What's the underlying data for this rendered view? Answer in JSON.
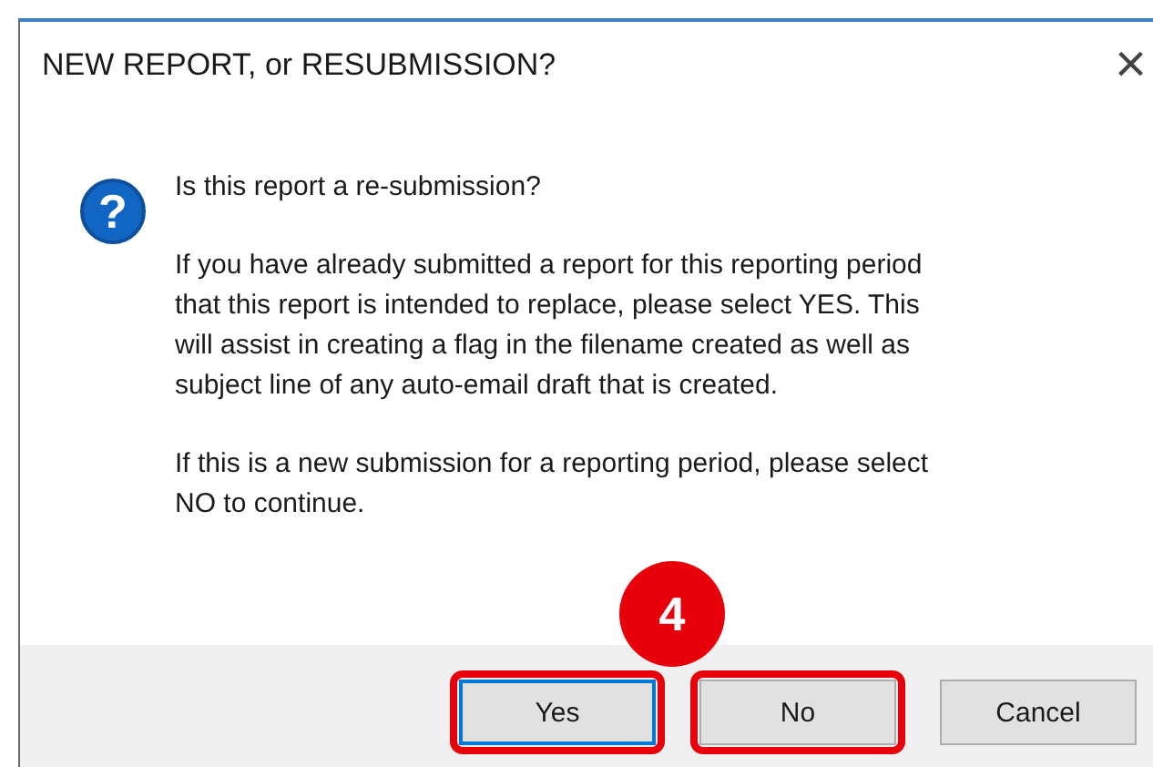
{
  "window": {
    "title": "NEW REPORT, or RESUBMISSION?",
    "close": "×"
  },
  "message": {
    "icon": "?",
    "question": "Is this report a re-submission?",
    "paragraphs": [
      [
        "If you have already submitted a report for this reporting period",
        "that this report is intended to replace, please select YES.  This",
        "will assist in creating a flag in the filename created as well as",
        "subject line of any auto-email draft that is created."
      ],
      [
        "If this is a new submission for a reporting period, please select",
        "NO to continue."
      ]
    ]
  },
  "annotation": {
    "badge": "4"
  },
  "buttons": [
    {
      "label": "Yes",
      "default": true,
      "highlighted": true
    },
    {
      "label": "No",
      "default": false,
      "highlighted": true
    },
    {
      "label": "Cancel",
      "default": false,
      "highlighted": false
    }
  ]
}
